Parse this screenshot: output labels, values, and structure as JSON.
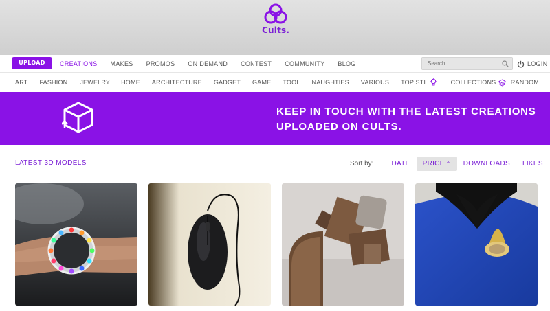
{
  "brand": {
    "name": "Cults.",
    "color": "#8a12e6"
  },
  "mainnav": {
    "upload_label": "UPLOAD",
    "items": [
      "CREATIONS",
      "MAKES",
      "PROMOS",
      "ON DEMAND",
      "CONTEST",
      "COMMUNITY",
      "BLOG"
    ],
    "active_index": 0,
    "search_placeholder": "Search...",
    "login_label": "LOGIN"
  },
  "catnav": {
    "items": [
      "ART",
      "FASHION",
      "JEWELRY",
      "HOME",
      "ARCHITECTURE",
      "GADGET",
      "GAME",
      "TOOL",
      "NAUGHTIES",
      "VARIOUS",
      "TOP STL",
      "COLLECTIONS"
    ],
    "random_label": "RANDOM"
  },
  "banner": {
    "line1": "KEEP IN TOUCH WITH THE LATEST CREATIONS",
    "line2": "UPLOADED ON CULTS."
  },
  "section": {
    "title": "LATEST 3D MODELS",
    "sort_label": "Sort by:",
    "sort_options": [
      "DATE",
      "PRICE",
      "DOWNLOADS",
      "LIKES"
    ],
    "sort_active": "PRICE"
  },
  "cards": [
    {
      "icon": "led-watch-image"
    },
    {
      "icon": "computer-mouse-image"
    },
    {
      "icon": "3d-printed-model-image"
    },
    {
      "icon": "starfleet-badge-image"
    }
  ]
}
